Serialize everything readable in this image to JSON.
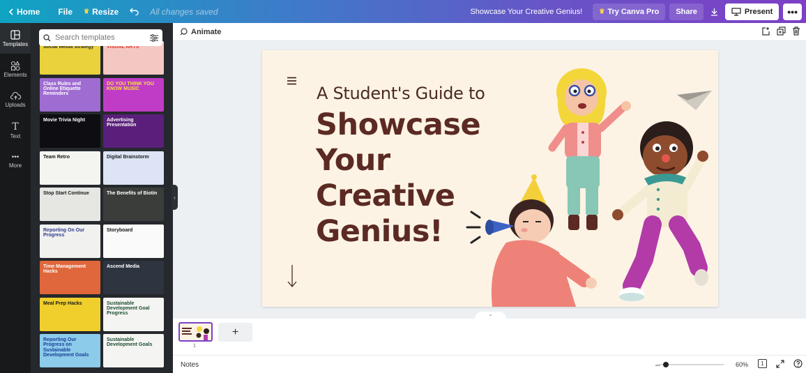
{
  "topbar": {
    "home": "Home",
    "file": "File",
    "resize": "Resize",
    "saved_status": "All changes saved",
    "doc_title": "Showcase Your Creative Genius!",
    "try_pro": "Try Canva Pro",
    "share": "Share",
    "present": "Present"
  },
  "rail": {
    "items": [
      {
        "label": "Templates",
        "icon": "template-icon"
      },
      {
        "label": "Elements",
        "icon": "elements-icon"
      },
      {
        "label": "Uploads",
        "icon": "upload-icon"
      },
      {
        "label": "Text",
        "icon": "text-icon"
      },
      {
        "label": "More",
        "icon": "more-icon"
      }
    ]
  },
  "panel": {
    "search_placeholder": "Search templates",
    "templates_left": [
      {
        "text": "Social Media Strategy",
        "bg": "#e9d23c",
        "fg": "#2b2b2b"
      },
      {
        "text": "Class Rules and Online Etiquette Reminders",
        "bg": "#9f6cd1",
        "fg": "#ffffff"
      },
      {
        "text": "Movie Trivia Night",
        "bg": "#0d0d12",
        "fg": "#ffffff"
      },
      {
        "text": "Team Retro",
        "bg": "#f4f4f1",
        "fg": "#111111"
      },
      {
        "text": "Stop Start Continue",
        "bg": "#e6e6e3",
        "fg": "#1a1a1a"
      },
      {
        "text": "Reporting On Our Progress",
        "bg": "#f1f1ef",
        "fg": "#2e3a8c"
      },
      {
        "text": "Time Management Hacks",
        "bg": "#e0673b",
        "fg": "#ffffff"
      },
      {
        "text": "Meal Prep Hacks",
        "bg": "#f0cf2c",
        "fg": "#1a1a1a"
      },
      {
        "text": "Reporting Our Progress on Sustainable Development Goals",
        "bg": "#8ccbea",
        "fg": "#1a3c9a"
      }
    ],
    "templates_right": [
      {
        "text": "VISUAL ARTS",
        "bg": "#f3c8c3",
        "fg": "#e0362c"
      },
      {
        "text": "DO YOU THINK YOU KNOW MUSIC",
        "bg": "#c13cc6",
        "fg": "#f4e23b"
      },
      {
        "text": "Advertising Presentation",
        "bg": "#5a1f7a",
        "fg": "#ffffff"
      },
      {
        "text": "Digital Brainstorm",
        "bg": "#dce4f5",
        "fg": "#1a1a1a"
      },
      {
        "text": "The Benefits of Biotin",
        "bg": "#3a3d3a",
        "fg": "#ffffff"
      },
      {
        "text": "Storyboard",
        "bg": "#fafafa",
        "fg": "#111111"
      },
      {
        "text": "Ascend Media",
        "bg": "#2e3440",
        "fg": "#ffffff"
      },
      {
        "text": "Sustainable Development Goal Progress",
        "bg": "#f4f4f2",
        "fg": "#1b4d2e"
      },
      {
        "text": "Sustainable Development Goals",
        "bg": "#f4f4f2",
        "fg": "#1b4d2e"
      }
    ]
  },
  "toolbar": {
    "animate": "Animate"
  },
  "slide": {
    "subtitle": "A Student's Guide to",
    "title": "Showcase Your Creative Genius!"
  },
  "pages": {
    "page_number": "1",
    "thumb_title": "Showcase Your Creative Genius!"
  },
  "footer": {
    "notes": "Notes",
    "zoom": "60%",
    "page_count": "1"
  },
  "colors": {
    "accent": "#7d3fc6",
    "slide_bg": "#fdf3e4",
    "slide_text": "#5b2a23"
  }
}
